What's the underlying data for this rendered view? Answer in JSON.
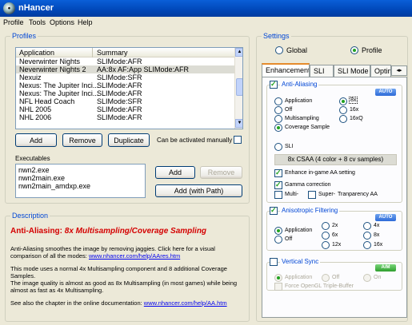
{
  "window": {
    "title": "nHancer",
    "icon_glyph": "•"
  },
  "menu": [
    "Profile",
    "Tools",
    "Options",
    "Help"
  ],
  "profiles": {
    "group_label": "Profiles",
    "columns": [
      "Application",
      "Summary"
    ],
    "rows": [
      {
        "app": "Neverwinter Nights",
        "summary": "SLIMode:AFR"
      },
      {
        "app": "Neverwinter Nights 2",
        "summary": "AA:8x AF:App SLIMode:AFR"
      },
      {
        "app": "Nexuiz",
        "summary": "SLIMode:SFR"
      },
      {
        "app": "Nexus: The Jupiter Inci...",
        "summary": "SLIMode:AFR"
      },
      {
        "app": "Nexus: The Jupiter Inci...",
        "summary": "SLIMode:AFR"
      },
      {
        "app": "NFL Head Coach",
        "summary": "SLIMode:SFR"
      },
      {
        "app": "NHL 2005",
        "summary": "SLIMode:AFR"
      },
      {
        "app": "NHL 2006",
        "summary": "SLIMode:AFR"
      }
    ],
    "buttons": {
      "add": "Add",
      "remove": "Remove",
      "duplicate": "Duplicate"
    },
    "activate_manually": "Can be activated manually",
    "executables_label": "Executables",
    "executables": [
      "nwn2.exe",
      "nwn2main.exe",
      "nwn2main_amdxp.exe"
    ],
    "exe_buttons": {
      "add": "Add",
      "remove": "Remove",
      "add_with_path": "Add (with Path)"
    }
  },
  "description": {
    "group_label": "Description",
    "heading_prefix": "Anti-Aliasing:",
    "heading_mode": "8x Multisampling/Coverage Sampling",
    "p1": "Anti-Aliasing smoothes the image by removing jaggies. Click here for a visual comparison of all the modes:",
    "link1": "www.nhancer.com/help/AAres.htm",
    "p2": "This mode uses a normal 4x Multisampling component and 8 additional Coverage Samples.",
    "p3": "The image quality is almost as good as 8x Multisampling (in most games) while being almost as fast as 4x Multisampling.",
    "p4": "See also the chapter in the online documentation:",
    "link2": "www.nhancer.com/help/AA.htm"
  },
  "settings": {
    "group_label": "Settings",
    "scope": {
      "global": "Global",
      "profile": "Profile",
      "selected": "profile"
    },
    "tabs": [
      "Enhancements",
      "SLI",
      "SLI Mode",
      "Optim"
    ],
    "aa": {
      "label": "Anti-Aliasing",
      "auto": "AUTO",
      "modes": [
        "Application",
        "Off",
        "Multisampling",
        "Coverage Sample"
      ],
      "levels": [
        "8x",
        "16x",
        "16xQ"
      ],
      "sli": "SLI",
      "selected_text": "8x CSAA (4 color + 8 cv samples)",
      "enhance": "Enhance in-game AA setting",
      "gamma": "Gamma correction",
      "multi": "Multi-",
      "super": "Super-",
      "trans": "Tranparency AA"
    },
    "af": {
      "label": "Anisotropic Filtering",
      "auto": "AUTO",
      "modes": [
        "Application",
        "Off"
      ],
      "levels": [
        "2x",
        "4x",
        "6x",
        "8x",
        "12x",
        "16x"
      ]
    },
    "vsync": {
      "label": "Vertical Sync",
      "am": "A/M",
      "modes": [
        "Application",
        "Off",
        "On"
      ],
      "triple": "Force OpenGL Triple-Buffer"
    }
  },
  "colors": {
    "title_blue": "#0a5fd8",
    "group_label": "#0046d5",
    "heading_red": "#d40000",
    "link": "#0000ee",
    "selection": "#dcdcd4"
  }
}
